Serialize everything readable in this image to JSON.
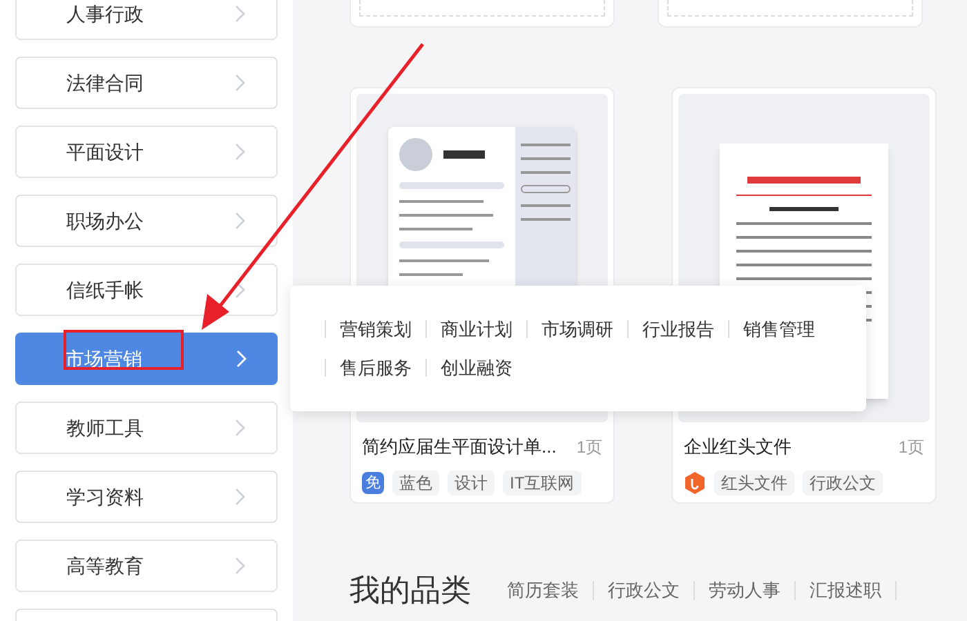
{
  "sidebar": {
    "items": [
      {
        "label": "人事行政",
        "selected": false
      },
      {
        "label": "法律合同",
        "selected": false
      },
      {
        "label": "平面设计",
        "selected": false
      },
      {
        "label": "职场办公",
        "selected": false
      },
      {
        "label": "信纸手帐",
        "selected": false
      },
      {
        "label": "市场营销",
        "selected": true
      },
      {
        "label": "教师工具",
        "selected": false
      },
      {
        "label": "学习资料",
        "selected": false
      },
      {
        "label": "高等教育",
        "selected": false
      },
      {
        "selected": false
      }
    ]
  },
  "popup": {
    "items": [
      "营销策划",
      "商业计划",
      "市场调研",
      "行业报告",
      "销售管理",
      "售后服务",
      "创业融资"
    ]
  },
  "cards": [
    {
      "kind": "resume",
      "title": "简约应届生平面设计单...",
      "pages": "1页",
      "badge": {
        "kind": "free",
        "text": "免"
      },
      "tags": [
        "蓝色",
        "设计",
        "IT互联网"
      ]
    },
    {
      "kind": "document",
      "title": "企业红头文件",
      "pages": "1页",
      "badge": {
        "kind": "brand"
      },
      "tags": [
        "红头文件",
        "行政公文"
      ]
    }
  ],
  "category": {
    "title": "我的品类",
    "links": [
      "简历套装",
      "行政公文",
      "劳动人事",
      "汇报述职"
    ]
  }
}
